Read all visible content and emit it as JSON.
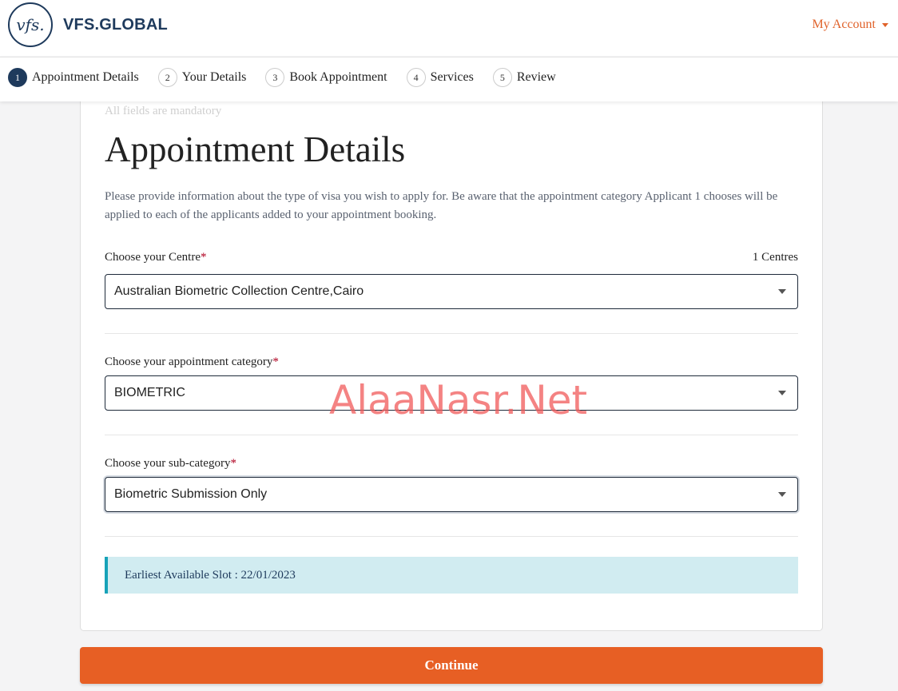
{
  "header": {
    "logo_mark": "vfs.",
    "logo_text": "VFS.GLOBAL",
    "account_label": "My Account"
  },
  "steps": [
    {
      "num": "1",
      "label": "Appointment Details",
      "active": true
    },
    {
      "num": "2",
      "label": "Your Details",
      "active": false
    },
    {
      "num": "3",
      "label": "Book Appointment",
      "active": false
    },
    {
      "num": "4",
      "label": "Services",
      "active": false
    },
    {
      "num": "5",
      "label": "Review",
      "active": false
    }
  ],
  "form": {
    "mandatory_note": "All fields are mandatory",
    "title": "Appointment Details",
    "intro": "Please provide information about the type of visa you wish to apply for. Be aware that the appointment category Applicant 1 chooses will be applied to each of the applicants added to your appointment booking.",
    "centre": {
      "label": "Choose your Centre",
      "required_mark": "*",
      "count": "1 Centres",
      "value": "Australian Biometric Collection Centre,Cairo"
    },
    "category": {
      "label": "Choose your appointment category",
      "required_mark": "*",
      "value": "BIOMETRIC"
    },
    "subcategory": {
      "label": "Choose your sub-category",
      "required_mark": "*",
      "value": "Biometric Submission Only"
    },
    "slot_text": "Earliest Available Slot : 22/01/2023",
    "continue_label": "Continue"
  },
  "watermark": "AlaaNasr.Net",
  "colors": {
    "brand_navy": "#1e3a5c",
    "accent_orange": "#e75f24",
    "info_bg": "#d1ecf1",
    "info_border": "#17a2b8"
  }
}
